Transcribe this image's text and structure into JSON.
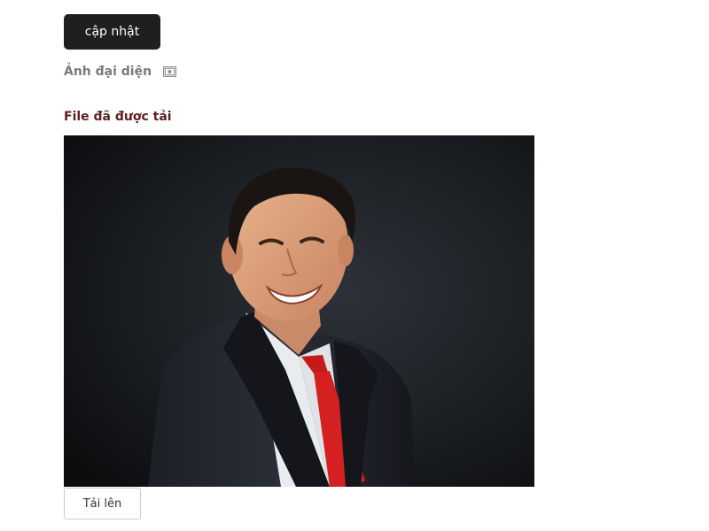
{
  "form": {
    "update_button_label": "cập nhật",
    "avatar_label": "Ảnh đại diện",
    "avatar_icon": "image-icon",
    "uploaded_title": "File đã được tải",
    "uploaded_title_color": "#5b1f23",
    "upload_button_label": "Tải lên"
  },
  "photo": {
    "subject": "man-in-suit-red-tie-portrait"
  }
}
